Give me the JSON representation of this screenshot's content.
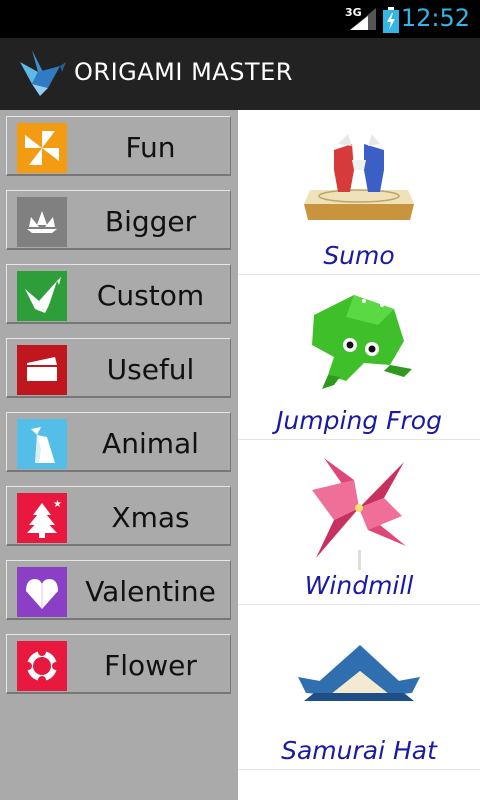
{
  "status_bar": {
    "network": "3G",
    "time": "12:52",
    "accent_color": "#33b5e5"
  },
  "action_bar": {
    "title": "ORIGAMI MASTER",
    "logo_icon": "bird-logo-icon"
  },
  "sidebar": {
    "items": [
      {
        "label": "Fun",
        "icon": "pinwheel-icon",
        "color": "#f39c12"
      },
      {
        "label": "Bigger",
        "icon": "lotus-icon",
        "color": "#808080"
      },
      {
        "label": "Custom",
        "icon": "crane-icon",
        "color": "#2e9e3a"
      },
      {
        "label": "Useful",
        "icon": "wallet-icon",
        "color": "#c0161d"
      },
      {
        "label": "Animal",
        "icon": "penguin-icon",
        "color": "#54bde8"
      },
      {
        "label": "Xmas",
        "icon": "xmas-tree-icon",
        "color": "#e8183e"
      },
      {
        "label": "Valentine",
        "icon": "heart-icon",
        "color": "#8a3fc4"
      },
      {
        "label": "Flower",
        "icon": "flower-icon",
        "color": "#e8183e"
      }
    ]
  },
  "content": {
    "items": [
      {
        "name": "Sumo",
        "icon": "sumo-origami-icon"
      },
      {
        "name": "Jumping Frog",
        "icon": "frog-origami-icon"
      },
      {
        "name": "Windmill",
        "icon": "windmill-origami-icon"
      },
      {
        "name": "Samurai Hat",
        "icon": "samurai-hat-origami-icon"
      }
    ]
  }
}
